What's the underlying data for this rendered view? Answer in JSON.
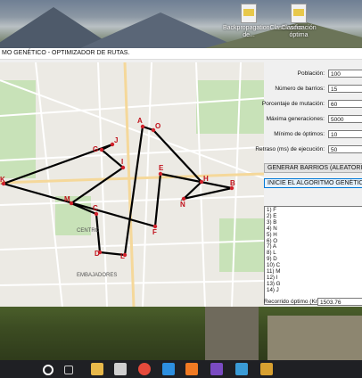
{
  "desktop": {
    "icons": [
      {
        "label": "BackpropagationClasificador de...",
        "icon": "document-icon"
      },
      {
        "label": "Clasificación óptima",
        "icon": "document-icon"
      }
    ]
  },
  "window": {
    "title": "MO GENÉTICO - OPTIMIZADOR DE RUTAS."
  },
  "form": {
    "poblacion": {
      "label": "Población:",
      "value": "100"
    },
    "barrios": {
      "label": "Número de barrios:",
      "value": "15"
    },
    "mutacion": {
      "label": "Porcentaje de mutación:",
      "value": "60"
    },
    "generaciones": {
      "label": "Máxima generaciones:",
      "value": "5000"
    },
    "optimos": {
      "label": "Mínimo de óptimos:",
      "value": "10"
    },
    "retraso": {
      "label": "Retraso (ms) de ejecución:",
      "value": "50"
    },
    "generate_button": "GENERAR BARRIOS (ALEATORIOS)",
    "start_button": "INICIE EL ALGORITMO GENÉTICO",
    "route_list": [
      "1) F",
      "2) E",
      "3) B",
      "4) N",
      "5) H",
      "6) O",
      "7) A",
      "8) L",
      "9) D",
      "10) C",
      "11) M",
      "12) I",
      "13) G",
      "14) J"
    ],
    "best_label": "Recorrido óptimo (Km):",
    "best_value": "1503.76"
  },
  "map": {
    "nodes": [
      {
        "id": "K",
        "label": "K"
      },
      {
        "id": "G",
        "label": "G"
      },
      {
        "id": "J",
        "label": "J"
      },
      {
        "id": "A",
        "label": "A"
      },
      {
        "id": "O",
        "label": "O"
      },
      {
        "id": "E",
        "label": "E"
      },
      {
        "id": "H",
        "label": "H"
      },
      {
        "id": "B",
        "label": "B"
      },
      {
        "id": "N",
        "label": "N"
      },
      {
        "id": "F",
        "label": "F"
      },
      {
        "id": "M",
        "label": "M"
      },
      {
        "id": "C",
        "label": "C"
      },
      {
        "id": "D",
        "label": "D"
      },
      {
        "id": "L",
        "label": "L"
      },
      {
        "id": "I",
        "label": "I"
      }
    ],
    "street_labels": [
      "CENTRO",
      "EMBAJADORES"
    ],
    "route_color": "#000000",
    "node_color": "#d0202a",
    "label_color": "#c0101a"
  },
  "taskbar": {
    "items": [
      "start-search-icon",
      "task-view-icon",
      "file-explorer-icon",
      "store-icon",
      "chrome-icon",
      "vscode-icon",
      "xampp-icon",
      "visual-studio-icon",
      "terminal-icon",
      "app-icon"
    ]
  }
}
